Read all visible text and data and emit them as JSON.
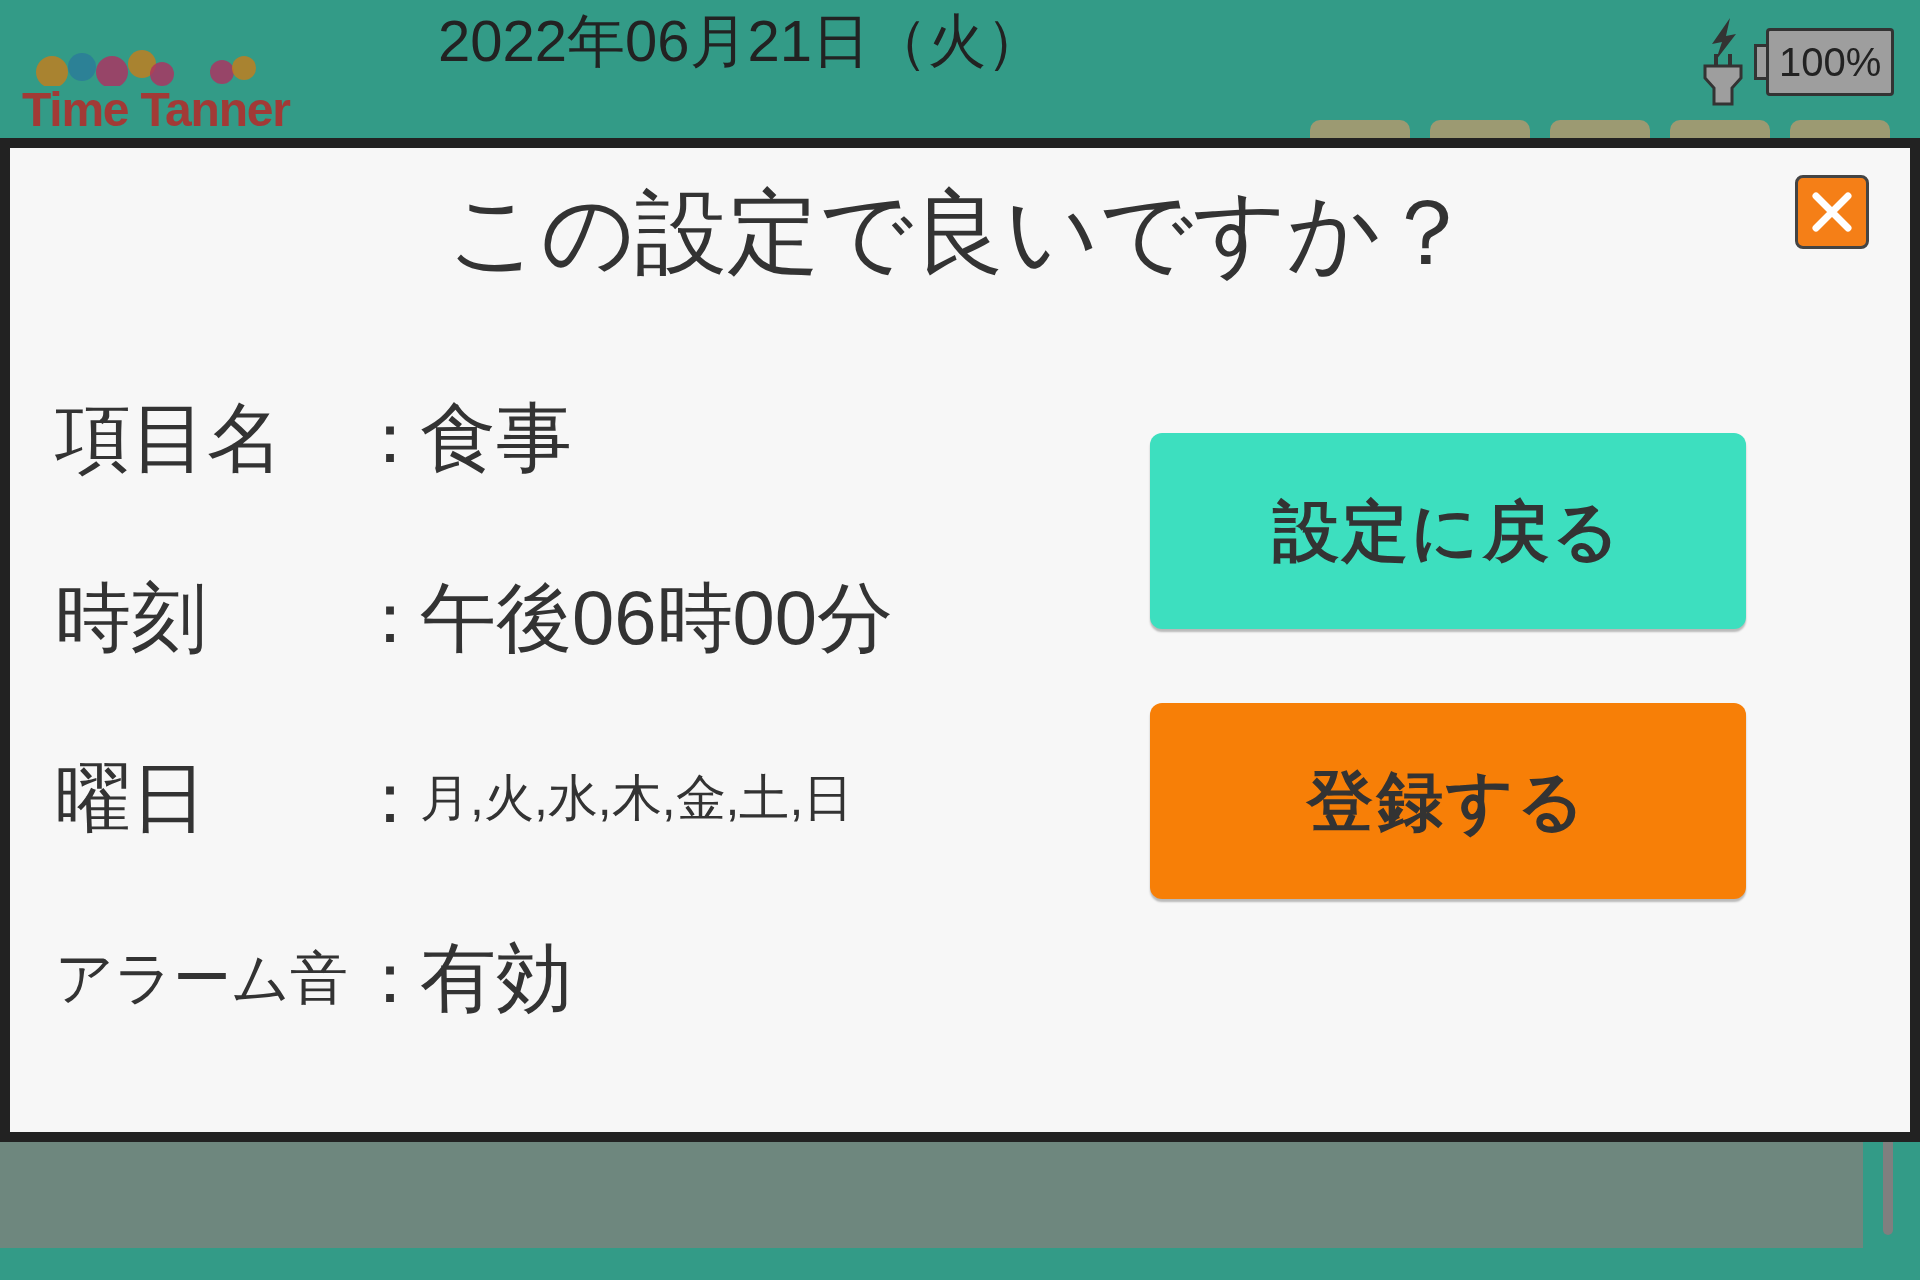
{
  "header": {
    "logo": "Time Tanner",
    "date": "2022年06月21日（火）",
    "battery": "100%"
  },
  "dialog": {
    "title": "この設定で良いですか？",
    "fields": [
      {
        "kind": "plain",
        "label": "項目名",
        "colon": "：",
        "value": "食事"
      },
      {
        "kind": "plain",
        "label": "時刻",
        "colon": "：",
        "value": "午後06時00分"
      },
      {
        "kind": "list",
        "label": "曜日",
        "colon": "：",
        "value": "月,火,水,木,金,土,日"
      },
      {
        "kind": "long",
        "label": "アラーム音",
        "colon": "：",
        "value": "有効"
      }
    ],
    "buttons": [
      {
        "kind": "back",
        "label": "設定に戻る"
      },
      {
        "kind": "register",
        "label": "登録する"
      }
    ]
  }
}
